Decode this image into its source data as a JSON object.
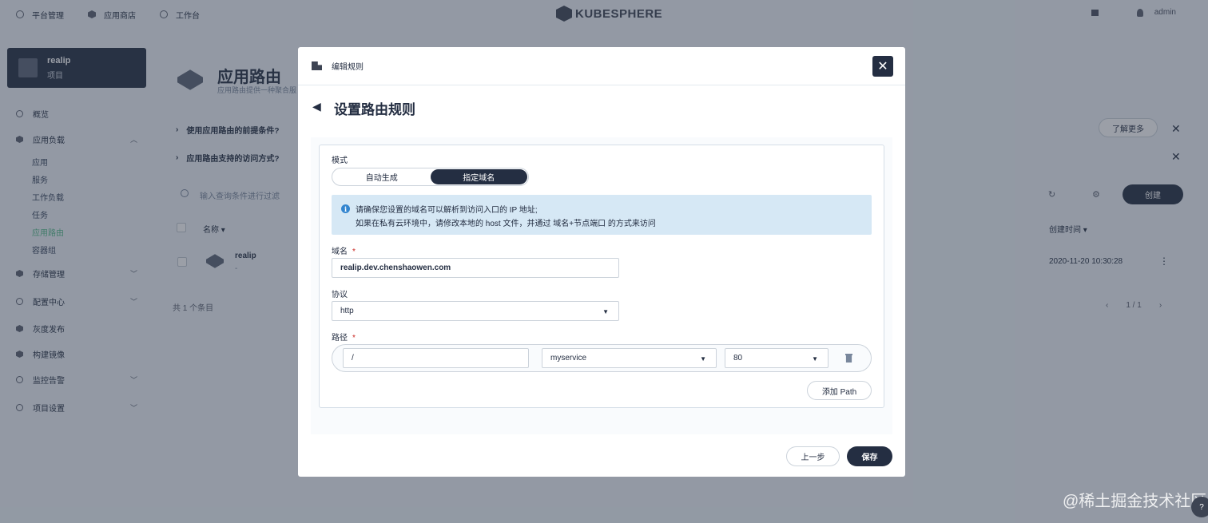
{
  "topbar": {
    "nav": [
      "平台管理",
      "应用商店",
      "工作台"
    ],
    "brand": "KUBESPHERE",
    "user": "admin"
  },
  "sidebar": {
    "project_name": "realip",
    "project_type": "项目",
    "items": [
      {
        "label": "概览"
      },
      {
        "label": "应用负载"
      },
      {
        "label": "存储管理"
      },
      {
        "label": "配置中心"
      },
      {
        "label": "灰度发布"
      },
      {
        "label": "构建镜像"
      },
      {
        "label": "监控告警"
      },
      {
        "label": "项目设置"
      }
    ],
    "sub_items": [
      "应用",
      "服务",
      "工作负载",
      "任务",
      "应用路由",
      "容器组"
    ]
  },
  "main": {
    "title": "应用路由",
    "description": "应用路由提供一种聚合服",
    "faq": [
      "使用应用路由的前提条件?",
      "应用路由支持的访问方式?"
    ],
    "learn_more": "了解更多",
    "search_placeholder": "输入查询条件进行过滤",
    "create": "创建",
    "columns": {
      "name": "名称",
      "created": "创建时间"
    },
    "row": {
      "name": "realip",
      "sub": "-",
      "created": "2020-11-20 10:30:28"
    },
    "total": "共 1 个条目",
    "pagination": "1 / 1"
  },
  "modal": {
    "header_title": "编辑规则",
    "title": "设置路由规则",
    "mode_label": "模式",
    "mode_options": [
      "自动生成",
      "指定域名"
    ],
    "info_line1": "请确保您设置的域名可以解析到访问入口的 IP 地址;",
    "info_line2": "如果在私有云环境中，请修改本地的 host 文件，并通过 域名+节点端口 的方式来访问",
    "domain_label": "域名",
    "domain_value": "realip.dev.chenshaowen.com",
    "protocol_label": "协议",
    "protocol_value": "http",
    "path_label": "路径",
    "path_value": "/",
    "service_value": "myservice",
    "port_value": "80",
    "add_path": "添加 Path",
    "prev": "上一步",
    "save": "保存"
  },
  "watermark": "@稀土掘金技术社区"
}
